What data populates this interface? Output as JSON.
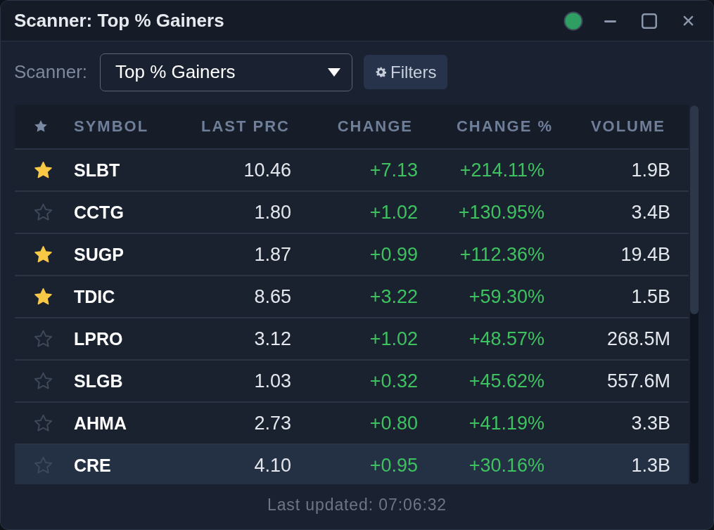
{
  "window": {
    "title": "Scanner: Top % Gainers",
    "connected": true
  },
  "toolbar": {
    "label": "Scanner:",
    "scanner_select": {
      "value": "Top % Gainers"
    },
    "filters_button": "Filters"
  },
  "table": {
    "columns": [
      "SYMBOL",
      "LAST PRC",
      "CHANGE",
      "CHANGE %",
      "VOLUME"
    ],
    "rows": [
      {
        "starred": true,
        "selected": false,
        "symbol": "SLBT",
        "last_prc": "10.46",
        "change": "+7.13",
        "change_pct": "+214.11%",
        "volume": "1.9B"
      },
      {
        "starred": false,
        "selected": false,
        "symbol": "CCTG",
        "last_prc": "1.80",
        "change": "+1.02",
        "change_pct": "+130.95%",
        "volume": "3.4B"
      },
      {
        "starred": true,
        "selected": false,
        "symbol": "SUGP",
        "last_prc": "1.87",
        "change": "+0.99",
        "change_pct": "+112.36%",
        "volume": "19.4B"
      },
      {
        "starred": true,
        "selected": false,
        "symbol": "TDIC",
        "last_prc": "8.65",
        "change": "+3.22",
        "change_pct": "+59.30%",
        "volume": "1.5B"
      },
      {
        "starred": false,
        "selected": false,
        "symbol": "LPRO",
        "last_prc": "3.12",
        "change": "+1.02",
        "change_pct": "+48.57%",
        "volume": "268.5M"
      },
      {
        "starred": false,
        "selected": false,
        "symbol": "SLGB",
        "last_prc": "1.03",
        "change": "+0.32",
        "change_pct": "+45.62%",
        "volume": "557.6M"
      },
      {
        "starred": false,
        "selected": false,
        "symbol": "AHMA",
        "last_prc": "2.73",
        "change": "+0.80",
        "change_pct": "+41.19%",
        "volume": "3.3B"
      },
      {
        "starred": false,
        "selected": true,
        "symbol": "CRE",
        "last_prc": "4.10",
        "change": "+0.95",
        "change_pct": "+30.16%",
        "volume": "1.3B"
      }
    ]
  },
  "status_bar": {
    "last_updated": "Last updated: 07:06:32"
  }
}
